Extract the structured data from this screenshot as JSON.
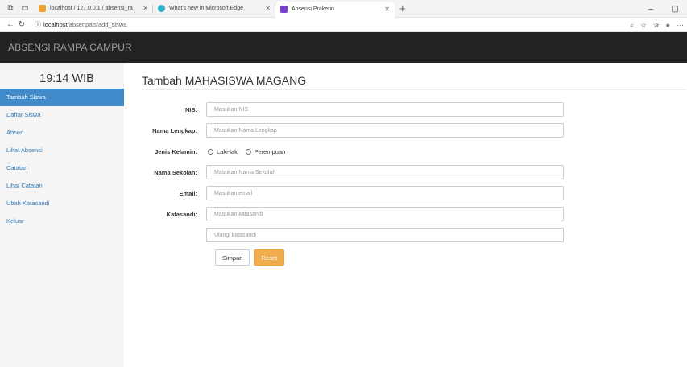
{
  "browser": {
    "tabs": [
      {
        "title": "localhost / 127.0.0.1 / absensi_ra",
        "favicon_color": "#f0a030",
        "active": false
      },
      {
        "title": "What's new in Microsoft Edge",
        "favicon_color": "#2bb0c8",
        "active": false
      },
      {
        "title": "Absensi Prakerin",
        "favicon_color": "#7b3fd0",
        "active": true
      }
    ],
    "new_tab": "+",
    "url_host": "localhost",
    "url_path": "/absenpais/add_siswa",
    "window_controls": [
      "–",
      "▢"
    ]
  },
  "app": {
    "brand": "ABSENSI RAMPA CAMPUR",
    "clock": "19:14 WIB",
    "menu": [
      {
        "label": "Tambah Siswa",
        "active": true
      },
      {
        "label": "Daftar Siswa",
        "active": false
      },
      {
        "label": "Absen",
        "active": false
      },
      {
        "label": "Lihat Absensi",
        "active": false
      },
      {
        "label": "Catatan",
        "active": false
      },
      {
        "label": "Lihat Catatan",
        "active": false
      },
      {
        "label": "Ubah Katasandi",
        "active": false
      },
      {
        "label": "Keluar",
        "active": false
      }
    ]
  },
  "form": {
    "title": "Tambah MAHASISWA MAGANG",
    "nis": {
      "label": "NIS:",
      "placeholder": "Masukan NIS"
    },
    "nama": {
      "label": "Nama Lengkap:",
      "placeholder": "Masukan Nama Lengkap"
    },
    "gender": {
      "label": "Jenis Kelamin:",
      "options": [
        "Laki-laki",
        "Perempuan"
      ]
    },
    "sekolah": {
      "label": "Nama Sekolah:",
      "placeholder": "Masukan Nama Sekolah"
    },
    "email": {
      "label": "Email:",
      "placeholder": "Masukan email"
    },
    "password": {
      "label": "Katasandi:",
      "placeholder": "Masukan katasandi"
    },
    "password_confirm": {
      "placeholder": "Ulangi katasandi"
    },
    "submit_label": "Simpan",
    "reset_label": "Reset"
  }
}
